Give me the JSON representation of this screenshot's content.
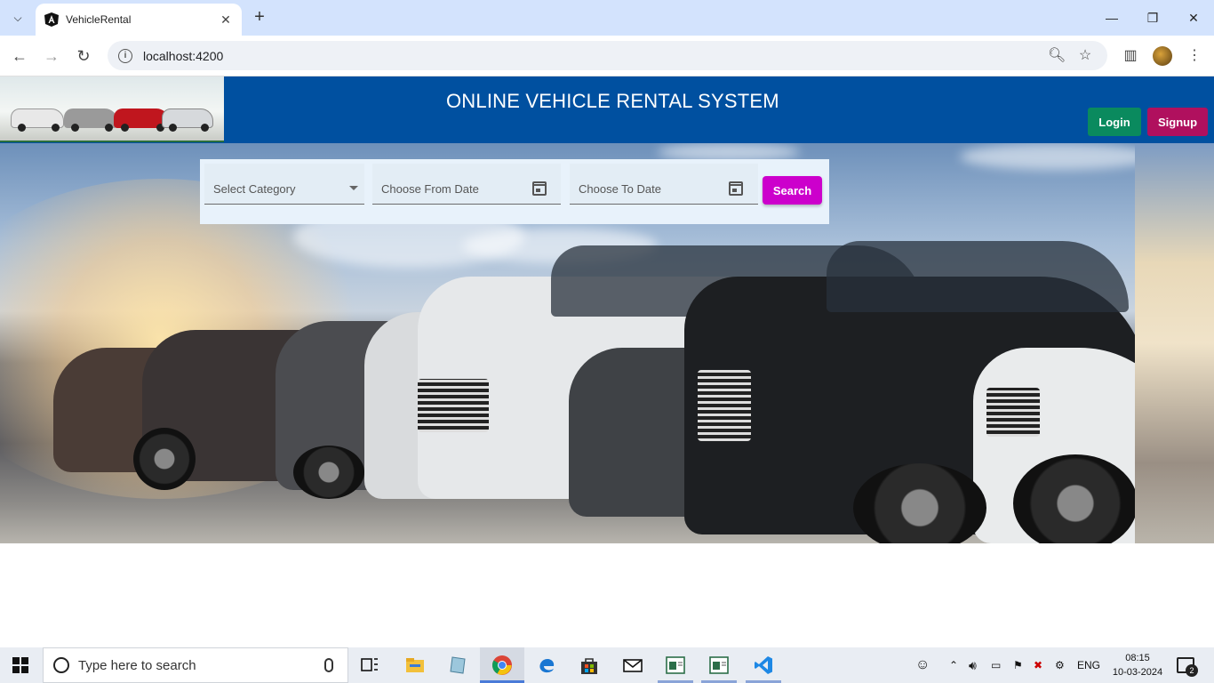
{
  "browser": {
    "tab_title": "VehicleRental",
    "url": "localhost:4200"
  },
  "app": {
    "title": "ONLINE VEHICLE RENTAL SYSTEM",
    "login_label": "Login",
    "signup_label": "Signup",
    "colors": {
      "header": "#0050a0",
      "login": "#0a8a5e",
      "signup": "#b0105e",
      "search": "#cc00cc"
    }
  },
  "search_panel": {
    "category_placeholder": "Select Category",
    "from_date_placeholder": "Choose From Date",
    "to_date_placeholder": "Choose To Date",
    "search_label": "Search"
  },
  "taskbar": {
    "search_placeholder": "Type here to search",
    "language": "ENG",
    "time": "08:15",
    "date": "10-03-2024",
    "notification_count": "2"
  }
}
